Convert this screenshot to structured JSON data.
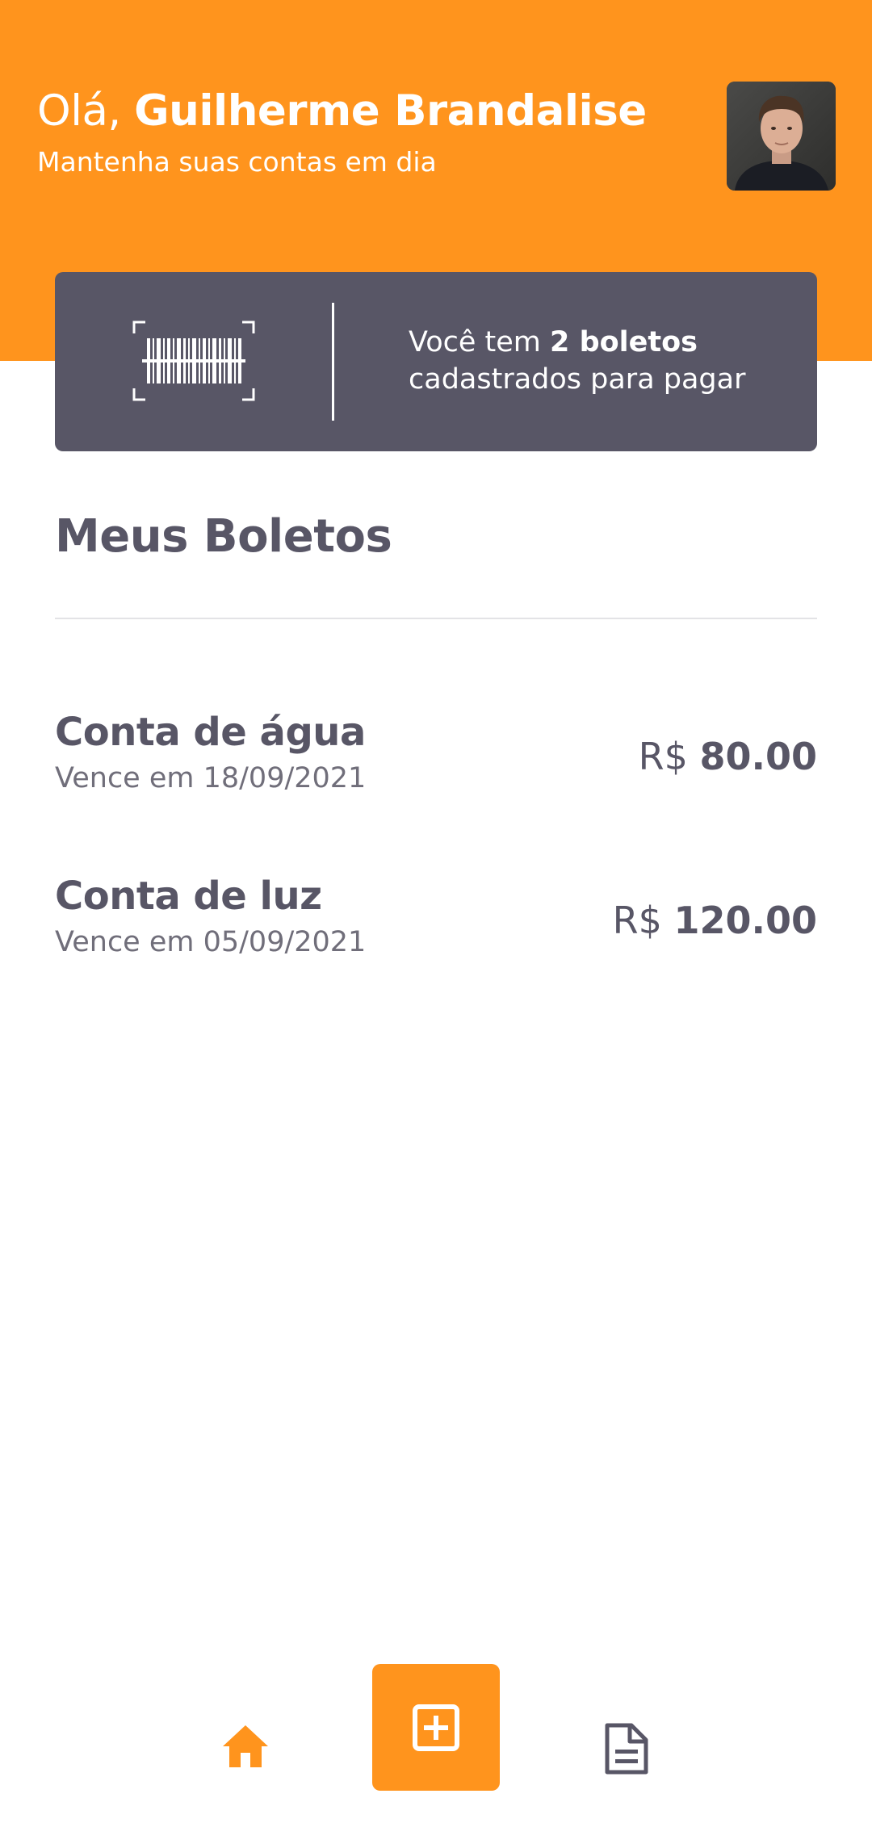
{
  "header": {
    "greeting_prefix": "Olá, ",
    "user_name": "Guilherme Brandalise",
    "subtitle": "Mantenha suas contas em dia",
    "avatar_alt": "Foto de perfil"
  },
  "summary": {
    "text_prefix": "Você tem ",
    "count_text": "2 boletos",
    "text_suffix": "cadastrados para pagar",
    "icon": "barcode-scan-icon"
  },
  "section": {
    "title": "Meus Boletos"
  },
  "bills": [
    {
      "name": "Conta de água",
      "due": "Vence em 18/09/2021",
      "currency": "R$",
      "amount": "80.00"
    },
    {
      "name": "Conta de luz",
      "due": "Vence em 05/09/2021",
      "currency": "R$",
      "amount": "120.00"
    }
  ],
  "nav": {
    "home_icon": "home-icon",
    "add_icon": "add-square-icon",
    "docs_icon": "document-icon"
  },
  "colors": {
    "primary": "#FF941D",
    "secondary": "#585666",
    "text_muted": "#706E7A",
    "divider": "#E3E3E6",
    "background": "#FFFFFF"
  }
}
